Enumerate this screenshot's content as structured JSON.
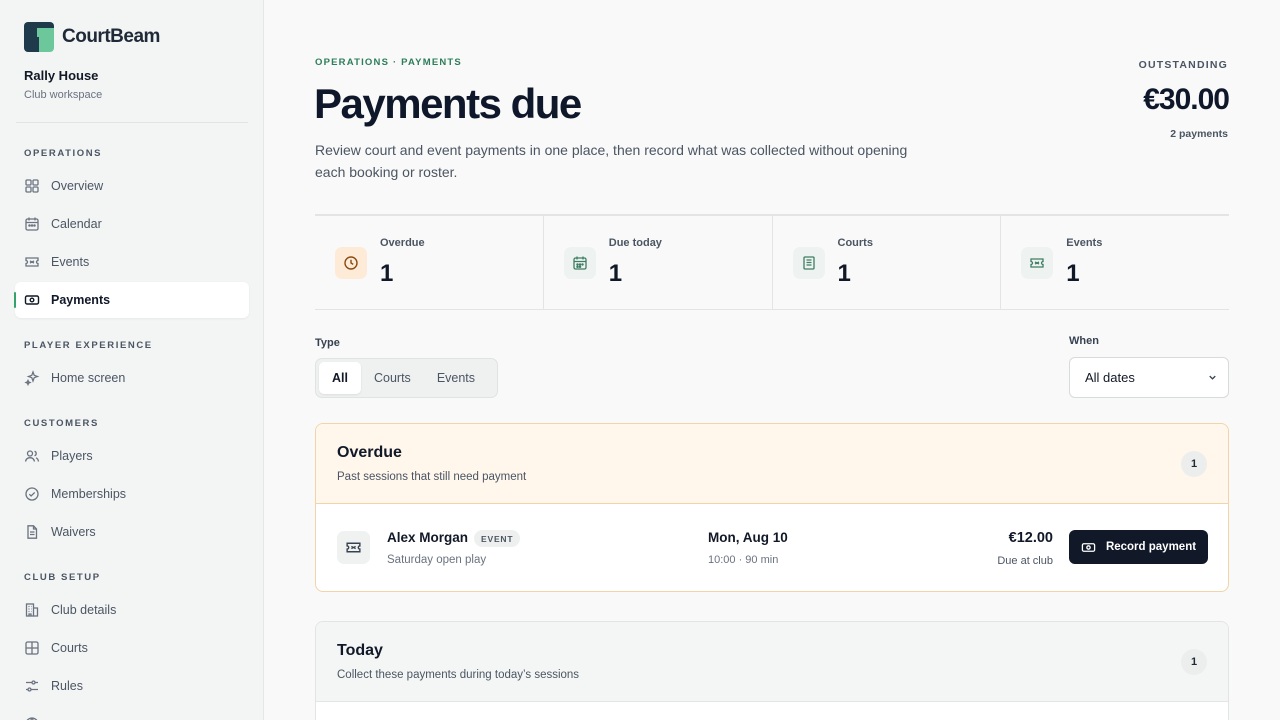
{
  "app": {
    "name": "CourtBeam",
    "workspace": "Rally House",
    "workspace_sub": "Club workspace"
  },
  "sidebar": {
    "operations_label": "OPERATIONS",
    "overview": "Overview",
    "calendar": "Calendar",
    "events": "Events",
    "payments": "Payments",
    "player_experience_label": "PLAYER EXPERIENCE",
    "home_screen": "Home screen",
    "customers_label": "CUSTOMERS",
    "players": "Players",
    "memberships": "Memberships",
    "waivers": "Waivers",
    "club_setup_label": "CLUB SETUP",
    "club_details": "Club details",
    "courts": "Courts",
    "rules": "Rules"
  },
  "header": {
    "breadcrumb": "OPERATIONS · PAYMENTS",
    "title": "Payments due",
    "description": "Review court and event payments in one place, then record what was collected without opening each booking or roster.",
    "outstanding_label": "OUTSTANDING",
    "outstanding_amount": "€30.00",
    "outstanding_count": "2 payments"
  },
  "stats": {
    "overdue_label": "Overdue",
    "overdue_value": "1",
    "due_today_label": "Due today",
    "due_today_value": "1",
    "courts_label": "Courts",
    "courts_value": "1",
    "events_label": "Events",
    "events_value": "1"
  },
  "filters": {
    "type_label": "Type",
    "type_all": "All",
    "type_courts": "Courts",
    "type_events": "Events",
    "when_label": "When",
    "when_value": "All dates"
  },
  "overdue_section": {
    "title": "Overdue",
    "subtitle": "Past sessions that still need payment",
    "count": "1",
    "row": {
      "name": "Alex Morgan",
      "tag": "EVENT",
      "detail": "Saturday open play",
      "date": "Mon, Aug 10",
      "time": "10:00 · 90 min",
      "amount": "€12.00",
      "note": "Due at club",
      "action": "Record payment"
    }
  },
  "today_section": {
    "title": "Today",
    "subtitle": "Collect these payments during today’s sessions",
    "count": "1"
  },
  "colors": {
    "accent": "#34a36b",
    "brand_dark": "#1f3a4a",
    "warning_bg": "#fff6ec",
    "button_dark": "#111827"
  }
}
